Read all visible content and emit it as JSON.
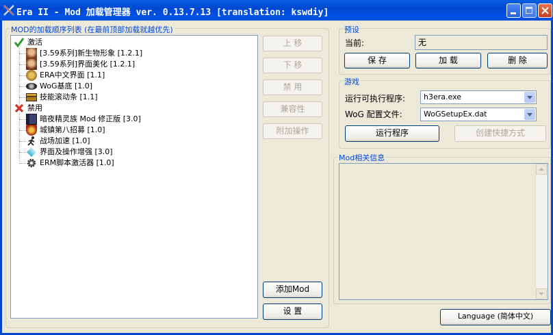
{
  "window": {
    "title": "Era II - Mod 加载管理器 ver. 0.13.7.13 [translation: kswdiy]"
  },
  "mod_list": {
    "legend": "MOD的加载顺序列表 (在最前顶部加载就越优先)",
    "enabled_group": {
      "label": "激活",
      "icon": "check-icon",
      "items": [
        {
          "label": "[3.59系列]新生物形象 [1.2.1]",
          "icon": "portrait-icon"
        },
        {
          "label": "[3.59系列]界面美化 [1.2.1]",
          "icon": "portrait-icon"
        },
        {
          "label": "ERA中文界面 [1.1]",
          "icon": "medal-icon"
        },
        {
          "label": "WoG基底 [1.0]",
          "icon": "eye-icon"
        },
        {
          "label": "技能滚动条 [1.1]",
          "icon": "chest-icon"
        }
      ]
    },
    "disabled_group": {
      "label": "禁用",
      "icon": "cross-icon",
      "items": [
        {
          "label": "暗夜精灵族 Mod 修正版 [3.0]",
          "icon": "book-icon"
        },
        {
          "label": "城镇第八招募 [1.0]",
          "icon": "shield-icon"
        },
        {
          "label": "战场加速 [1.0]",
          "icon": "runner-icon"
        },
        {
          "label": "界面及操作增强 [3.0]",
          "icon": "gem-icon"
        },
        {
          "label": "ERM脚本激活器 [1.0]",
          "icon": "gear-icon"
        }
      ]
    }
  },
  "side_buttons": {
    "move_up": "上 移",
    "move_down": "下 移",
    "disable": "禁 用",
    "compatibility": "兼容性",
    "extra_ops": "附加操作",
    "add_mod": "添加Mod",
    "settings": "设 置"
  },
  "preset": {
    "legend": "预设",
    "current_label": "当前:",
    "current_value": "无",
    "save": "保 存",
    "load": "加 载",
    "delete": "删 除"
  },
  "game": {
    "legend": "游戏",
    "exe_label": "运行可执行程序:",
    "exe_value": "h3era.exe",
    "config_label": "WoG 配置文件:",
    "config_value": "WoGSetupEx.dat",
    "run": "运行程序",
    "shortcut": "创建快捷方式"
  },
  "mod_info": {
    "legend": "Mod相关信息"
  },
  "language_button": "Language (简体中文)",
  "colors": {
    "title_bar": "#0047d0",
    "legend_text": "#0046d5",
    "dialog_bg": "#ece9d8"
  }
}
